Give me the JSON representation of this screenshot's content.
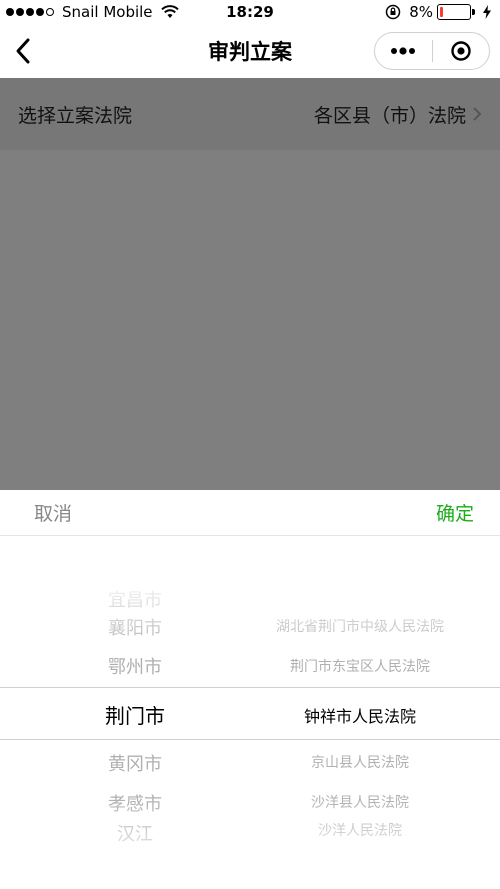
{
  "status_bar": {
    "carrier": "Snail Mobile",
    "time": "18:29",
    "battery_percent": "8%",
    "battery_level": 0.08,
    "battery_color": "#ff3b30"
  },
  "nav": {
    "title": "审判立案",
    "back_icon": "chevron-left-icon",
    "more_icon": "more-dots-icon",
    "close_icon": "target-circle-icon"
  },
  "court_select": {
    "label": "选择立案法院",
    "value": "各区县（市）法院"
  },
  "picker": {
    "cancel_label": "取消",
    "confirm_label": "确定",
    "confirm_color": "#1aad19",
    "cities": [
      "宜昌市",
      "襄阳市",
      "鄂州市",
      "荆门市",
      "黄冈市",
      "孝感市",
      "汉江"
    ],
    "selected_city": "荆门市",
    "courts": [
      "湖北省荆门市中级人民法院",
      "荆门市东宝区人民法院",
      "钟祥市人民法院",
      "京山县人民法院",
      "沙洋县人民法院",
      "沙洋人民法院"
    ],
    "selected_court": "钟祥市人民法院"
  }
}
